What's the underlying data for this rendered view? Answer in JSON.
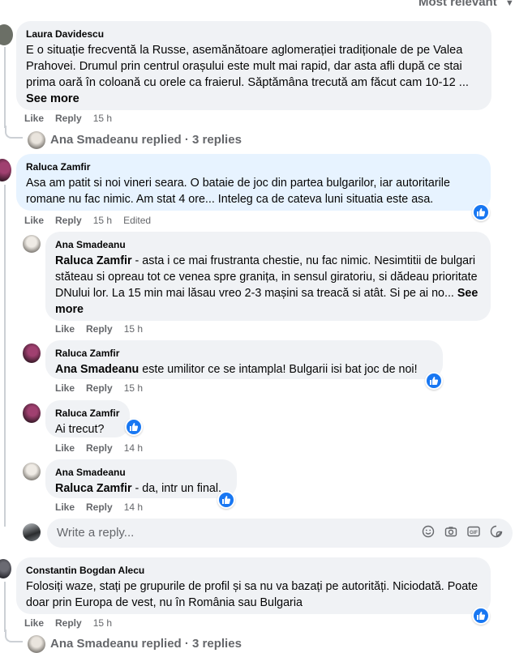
{
  "header": {
    "sort_label": "Most relevant"
  },
  "comments": {
    "c1": {
      "author": "Laura Davidescu",
      "text": "E o situație frecventă la Russe, asemănătoare aglomerației tradiționale de pe Valea Prahovei. Drumul prin centrul orașului este mult mai rapid, dar asta afli după ce stai prima oară în coloană cu orele ca fraierul. Săptămâna trecută am făcut cam 10-12 ...",
      "see_more": "See more",
      "like": "Like",
      "reply": "Reply",
      "time": "15 h",
      "replies_label": "Ana Smadeanu replied · 3 replies"
    },
    "c2": {
      "author": "Raluca Zamfir",
      "text": "Asa am patit si noi vineri seara. O bataie de joc din partea bulgarilor, iar autoritarile romane nu fac nimic. Am stat 4 ore... Inteleg ca de cateva luni situatia este asa.",
      "like": "Like",
      "reply": "Reply",
      "time": "15 h",
      "edited": "Edited"
    },
    "r1": {
      "author": "Ana Smadeanu",
      "mention": "Raluca Zamfir",
      "text": " - asta i ce mai frustranta chestie, nu fac nimic. Nesimtitii de bulgari stăteau si opreau tot ce venea spre granița, in sensul giratoriu, si dădeau prioritate DNului lor. La 15 min mai lăsau vreo 2-3 mașini sa treacă si atât. Si pe ai no...",
      "see_more": "See more",
      "like": "Like",
      "reply": "Reply",
      "time": "15 h"
    },
    "r2": {
      "author": "Raluca Zamfir",
      "mention": "Ana Smadeanu",
      "text": " este umilitor ce se intampla! Bulgarii isi bat joc de noi!",
      "like": "Like",
      "reply": "Reply",
      "time": "15 h"
    },
    "r3": {
      "author": "Raluca Zamfir",
      "text": "Ai trecut?",
      "like": "Like",
      "reply": "Reply",
      "time": "14 h"
    },
    "r4": {
      "author": "Ana Smadeanu",
      "mention": "Raluca Zamfir",
      "text": " - da, intr un final.",
      "like": "Like",
      "reply": "Reply",
      "time": "14 h"
    },
    "composer": {
      "placeholder": "Write a reply..."
    },
    "c3": {
      "author": "Constantin Bogdan Alecu",
      "text": "Folosiți waze, stați pe grupurile de profil și sa nu va bazați pe autorități. Niciodată. Poate doar prin Europa de vest, nu în România sau Bulgaria",
      "like": "Like",
      "reply": "Reply",
      "time": "15 h",
      "replies_label": "Ana Smadeanu replied · 3 replies"
    }
  },
  "colors": {
    "bubble": "#f0f2f5",
    "highlight": "#e7f3ff",
    "meta": "#65676b",
    "like_blue": "#1877f2"
  },
  "icons": [
    "chevron-down-icon",
    "like-reaction-icon",
    "emoji-icon",
    "camera-icon",
    "gif-icon",
    "sticker-icon"
  ]
}
